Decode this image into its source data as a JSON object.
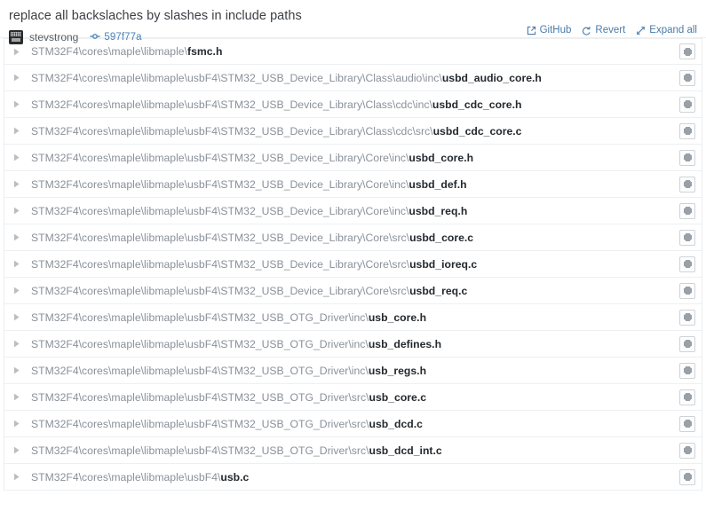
{
  "header": {
    "commit_title": "replace all backslaches by slashes in include paths",
    "author": "stevstrong",
    "commit_hash": "597f77a",
    "link_color": "#4a7ca8",
    "actions": [
      {
        "label": "GitHub",
        "icon": "external-link-icon"
      },
      {
        "label": "Revert",
        "icon": "revert-arrow-icon"
      },
      {
        "label": "Expand all",
        "icon": "expand-arrows-icon"
      }
    ]
  },
  "file_list": {
    "row_button_icon": "gear-icon",
    "disclosure_icon": "triangle-right-icon",
    "files": [
      {
        "path": "STM32F4\\cores\\maple\\libmaple\\",
        "filename": "fsmc.h"
      },
      {
        "path": "STM32F4\\cores\\maple\\libmaple\\usbF4\\STM32_USB_Device_Library\\Class\\audio\\inc\\",
        "filename": "usbd_audio_core.h"
      },
      {
        "path": "STM32F4\\cores\\maple\\libmaple\\usbF4\\STM32_USB_Device_Library\\Class\\cdc\\inc\\",
        "filename": "usbd_cdc_core.h"
      },
      {
        "path": "STM32F4\\cores\\maple\\libmaple\\usbF4\\STM32_USB_Device_Library\\Class\\cdc\\src\\",
        "filename": "usbd_cdc_core.c"
      },
      {
        "path": "STM32F4\\cores\\maple\\libmaple\\usbF4\\STM32_USB_Device_Library\\Core\\inc\\",
        "filename": "usbd_core.h"
      },
      {
        "path": "STM32F4\\cores\\maple\\libmaple\\usbF4\\STM32_USB_Device_Library\\Core\\inc\\",
        "filename": "usbd_def.h"
      },
      {
        "path": "STM32F4\\cores\\maple\\libmaple\\usbF4\\STM32_USB_Device_Library\\Core\\inc\\",
        "filename": "usbd_req.h"
      },
      {
        "path": "STM32F4\\cores\\maple\\libmaple\\usbF4\\STM32_USB_Device_Library\\Core\\src\\",
        "filename": "usbd_core.c"
      },
      {
        "path": "STM32F4\\cores\\maple\\libmaple\\usbF4\\STM32_USB_Device_Library\\Core\\src\\",
        "filename": "usbd_ioreq.c"
      },
      {
        "path": "STM32F4\\cores\\maple\\libmaple\\usbF4\\STM32_USB_Device_Library\\Core\\src\\",
        "filename": "usbd_req.c"
      },
      {
        "path": "STM32F4\\cores\\maple\\libmaple\\usbF4\\STM32_USB_OTG_Driver\\inc\\",
        "filename": "usb_core.h"
      },
      {
        "path": "STM32F4\\cores\\maple\\libmaple\\usbF4\\STM32_USB_OTG_Driver\\inc\\",
        "filename": "usb_defines.h"
      },
      {
        "path": "STM32F4\\cores\\maple\\libmaple\\usbF4\\STM32_USB_OTG_Driver\\inc\\",
        "filename": "usb_regs.h"
      },
      {
        "path": "STM32F4\\cores\\maple\\libmaple\\usbF4\\STM32_USB_OTG_Driver\\src\\",
        "filename": "usb_core.c"
      },
      {
        "path": "STM32F4\\cores\\maple\\libmaple\\usbF4\\STM32_USB_OTG_Driver\\src\\",
        "filename": "usb_dcd.c"
      },
      {
        "path": "STM32F4\\cores\\maple\\libmaple\\usbF4\\STM32_USB_OTG_Driver\\src\\",
        "filename": "usb_dcd_int.c"
      },
      {
        "path": "STM32F4\\cores\\maple\\libmaple\\usbF4\\",
        "filename": "usb.c"
      }
    ]
  }
}
